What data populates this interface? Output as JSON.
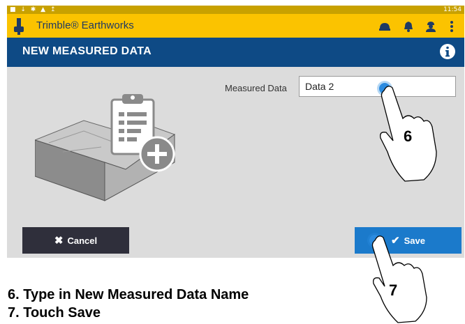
{
  "status_bar": {
    "time": "11:54",
    "icons": [
      "square-icon",
      "download-icon",
      "settings-icon",
      "warning-icon",
      "upload-icon"
    ]
  },
  "app_bar": {
    "title": "Trimble® Earthworks",
    "icons": [
      "helmet-icon",
      "bell-icon",
      "operator-icon",
      "more-vertical-icon"
    ],
    "background": "#fbc300"
  },
  "page": {
    "title": "NEW MEASURED DATA",
    "header_color": "#0e4a85"
  },
  "form": {
    "label": "Measured Data",
    "value": "Data 2"
  },
  "buttons": {
    "cancel": "Cancel",
    "save": "Save"
  },
  "callouts": {
    "step6": "6",
    "step7": "7"
  },
  "instructions": [
    "6. Type in New Measured Data Name",
    "7. Touch Save"
  ]
}
